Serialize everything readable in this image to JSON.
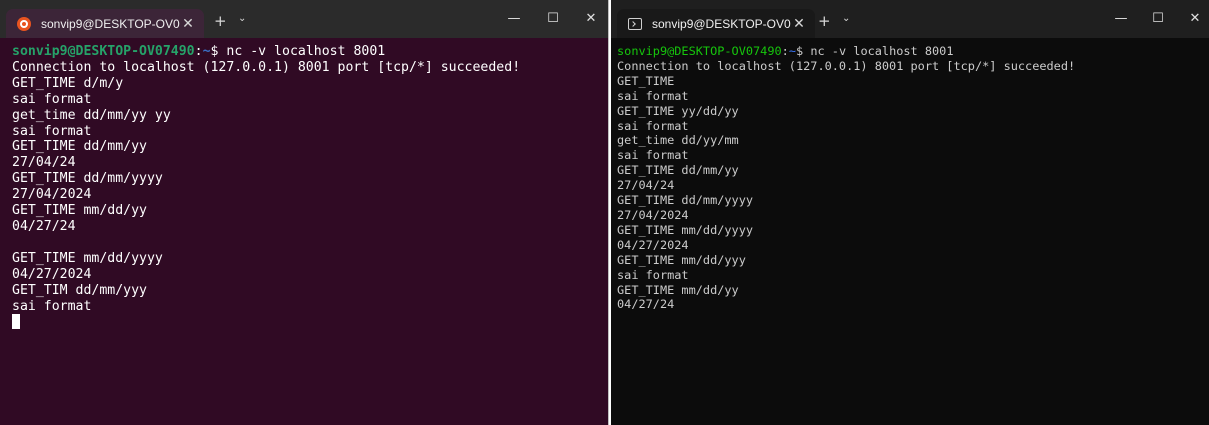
{
  "left_window": {
    "tab_title": "sonvip9@DESKTOP-OV07490: ",
    "tab_close": "✕",
    "new_tab": "+",
    "tab_dropdown": "⌄",
    "minimize": "—",
    "maximize": "☐",
    "close": "✕",
    "prompt_user": "sonvip9@DESKTOP-OV07490",
    "prompt_sep": ":",
    "prompt_path": "~",
    "prompt_dollar": "$ ",
    "command": "nc -v localhost 8001",
    "output": [
      "Connection to localhost (127.0.0.1) 8001 port [tcp/*] succeeded!",
      "GET_TIME d/m/y",
      "sai format",
      "get_time dd/mm/yy yy",
      "sai format",
      "GET_TIME dd/mm/yy",
      "27/04/24",
      "GET_TIME dd/mm/yyyy",
      "27/04/2024",
      "GET_TIME mm/dd/yy",
      "04/27/24",
      "",
      "GET_TIME mm/dd/yyyy",
      "04/27/2024",
      "GET_TIM dd/mm/yyy",
      "sai format"
    ]
  },
  "right_window": {
    "tab_title": "sonvip9@DESKTOP-OV07490: ",
    "tab_close": "✕",
    "new_tab": "+",
    "tab_dropdown": "⌄",
    "minimize": "—",
    "maximize": "☐",
    "close": "✕",
    "prompt_user": "sonvip9@DESKTOP-OV07490",
    "prompt_sep": ":",
    "prompt_path": "~",
    "prompt_dollar": "$ ",
    "command": "nc -v localhost 8001",
    "output": [
      "Connection to localhost (127.0.0.1) 8001 port [tcp/*] succeeded!",
      "GET_TIME",
      "sai format",
      "GET_TIME yy/dd/yy",
      "sai format",
      "get_time dd/yy/mm",
      "sai format",
      "GET_TIME dd/mm/yy",
      "27/04/24",
      "GET_TIME dd/mm/yyyy",
      "27/04/2024",
      "GET_TIME mm/dd/yyyy",
      "04/27/2024",
      "GET_TIME mm/dd/yyy",
      "sai format",
      "GET_TIME mm/dd/yy",
      "04/27/24"
    ]
  }
}
